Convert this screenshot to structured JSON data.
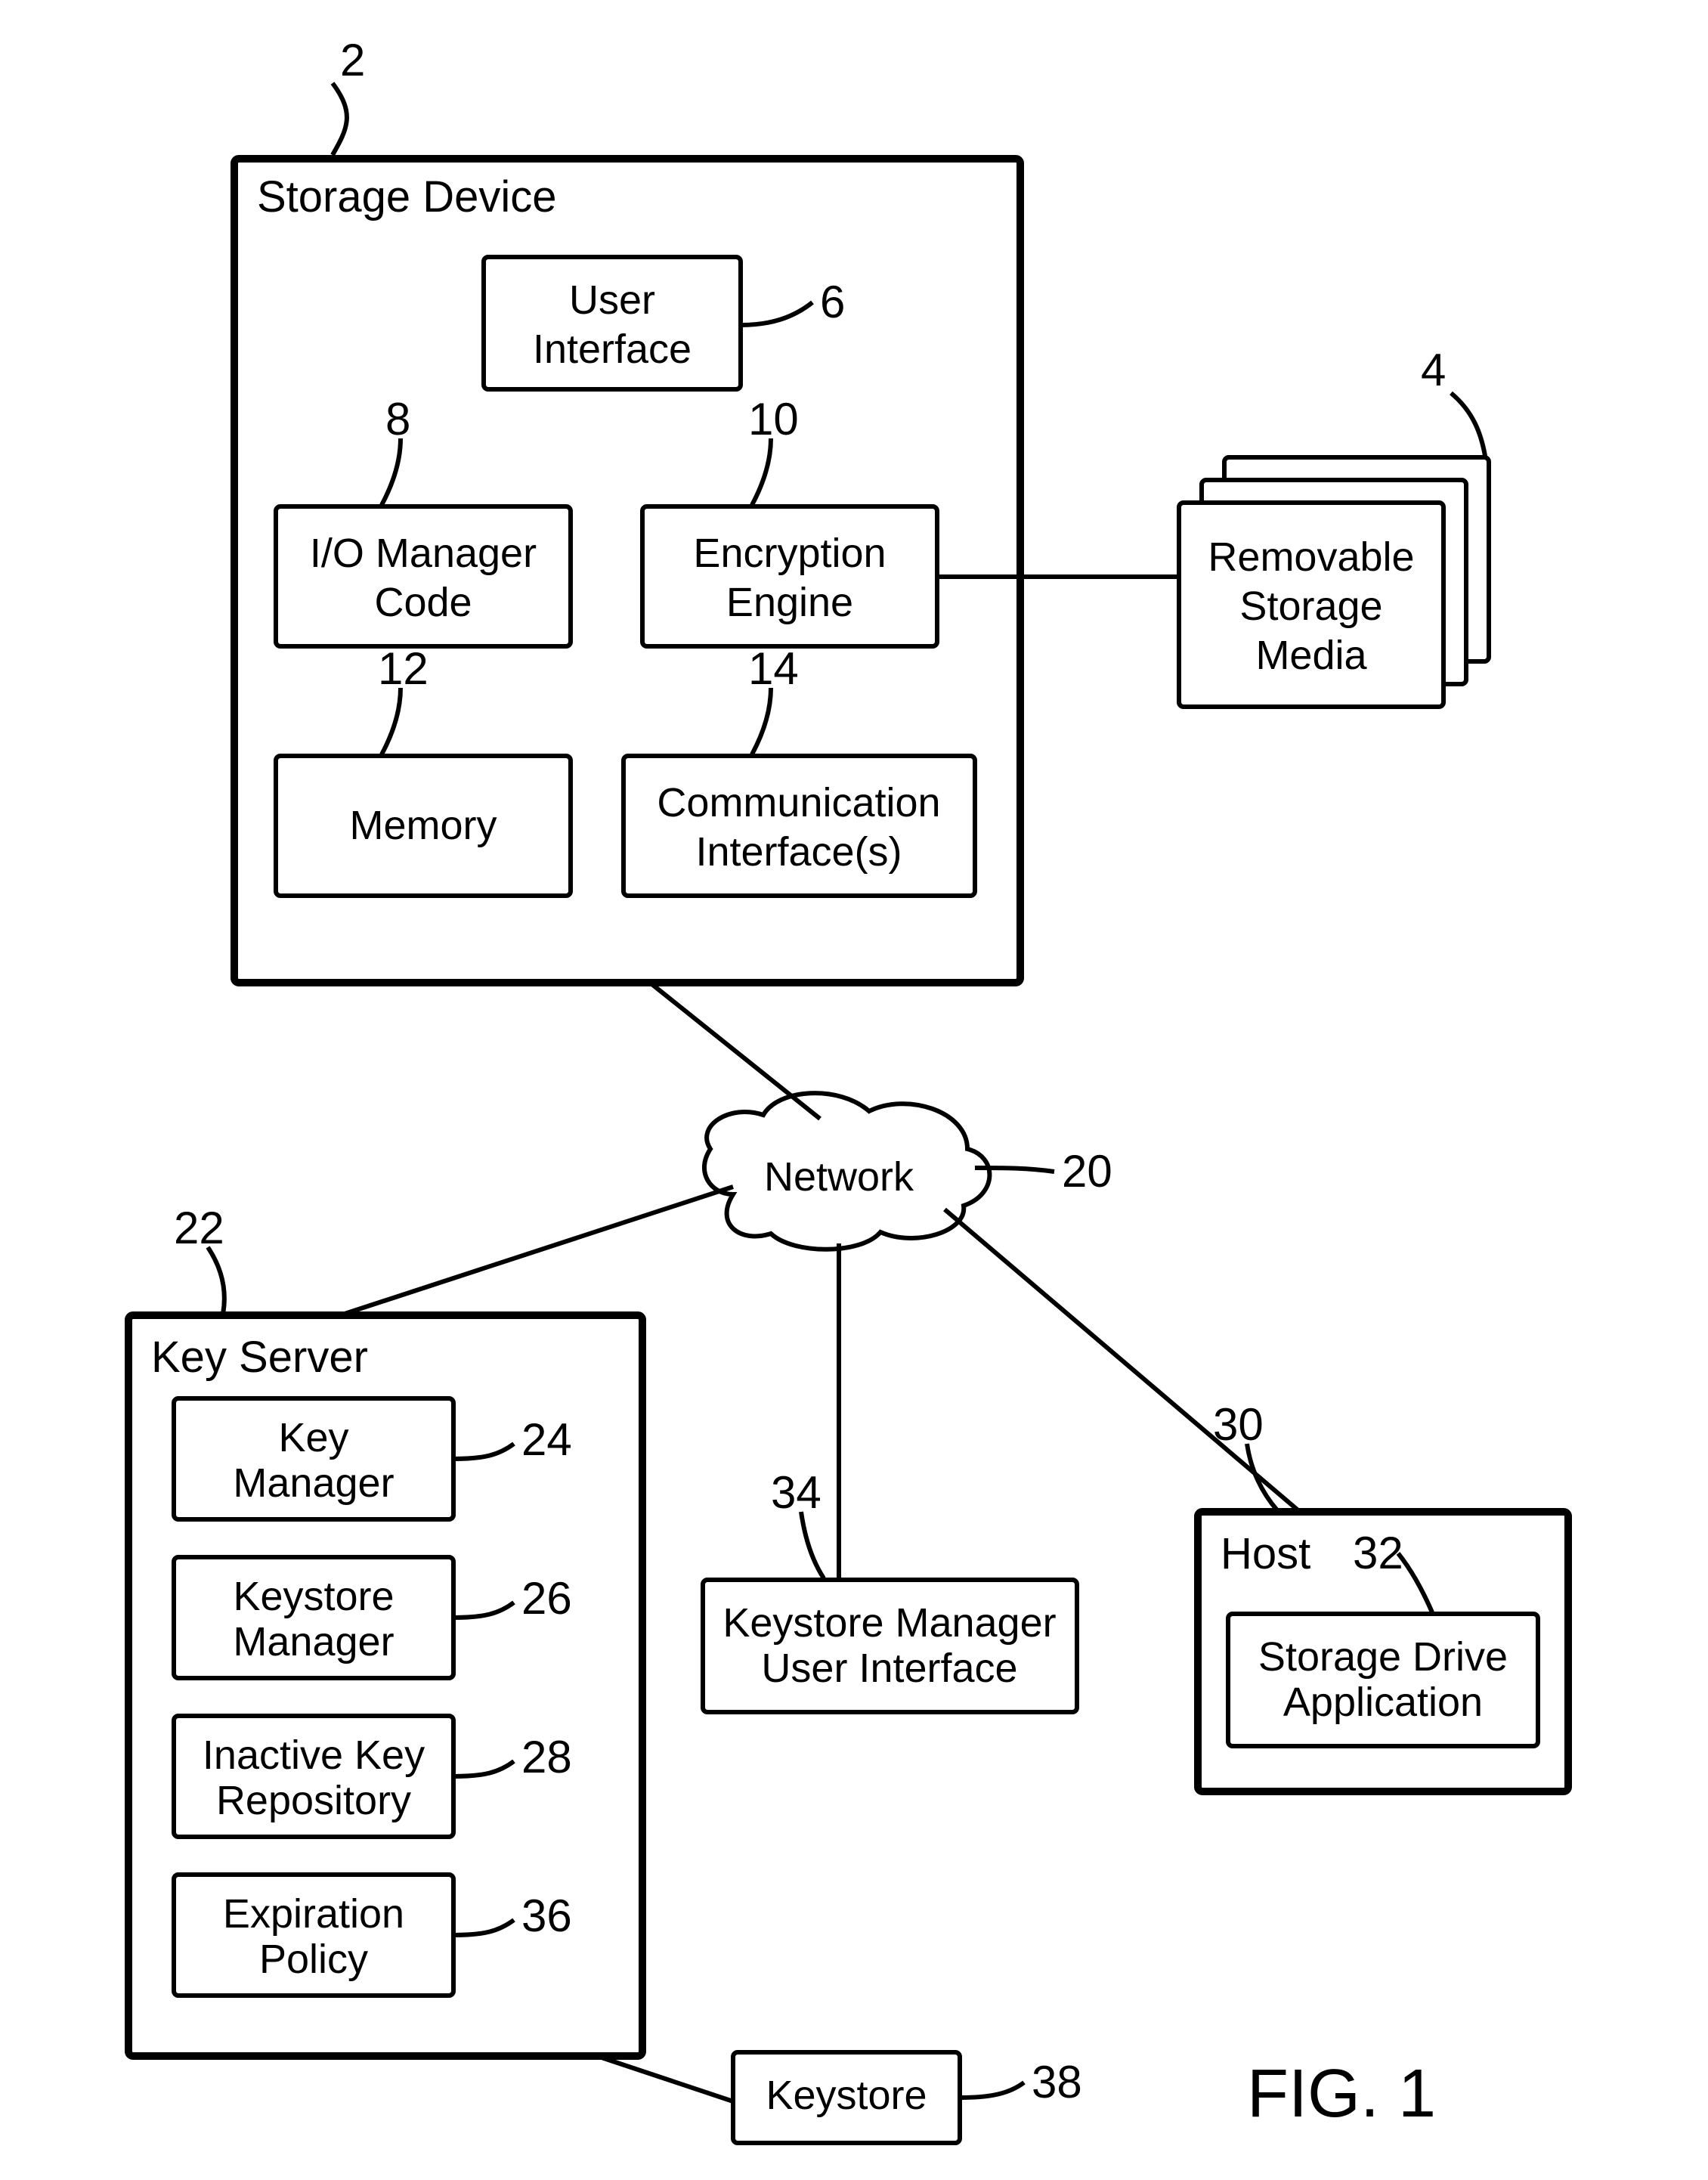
{
  "fig_label": "FIG. 1",
  "storage_device": {
    "title": "Storage Device",
    "ref": "2",
    "user_interface": {
      "line1": "User",
      "line2": "Interface",
      "ref": "6"
    },
    "io_manager": {
      "line1": "I/O Manager",
      "line2": "Code",
      "ref": "8"
    },
    "encryption": {
      "line1": "Encryption",
      "line2": "Engine",
      "ref": "10"
    },
    "memory": {
      "line1": "Memory",
      "ref": "12"
    },
    "comm": {
      "line1": "Communication",
      "line2": "Interface(s)",
      "ref": "14"
    }
  },
  "removable_media": {
    "line1": "Removable",
    "line2": "Storage",
    "line3": "Media",
    "ref": "4"
  },
  "network": {
    "label": "Network",
    "ref": "20"
  },
  "key_server": {
    "title": "Key Server",
    "ref": "22",
    "key_manager": {
      "line1": "Key",
      "line2": "Manager",
      "ref": "24"
    },
    "keystore_manager": {
      "line1": "Keystore",
      "line2": "Manager",
      "ref": "26"
    },
    "inactive_repo": {
      "line1": "Inactive Key",
      "line2": "Repository",
      "ref": "28"
    },
    "expiration": {
      "line1": "Expiration",
      "line2": "Policy",
      "ref": "36"
    }
  },
  "keystore_ui": {
    "line1": "Keystore Manager",
    "line2": "User Interface",
    "ref": "34"
  },
  "host": {
    "title": "Host",
    "ref": "30",
    "app": {
      "line1": "Storage Drive",
      "line2": "Application",
      "ref": "32"
    }
  },
  "keystore": {
    "label": "Keystore",
    "ref": "38"
  }
}
